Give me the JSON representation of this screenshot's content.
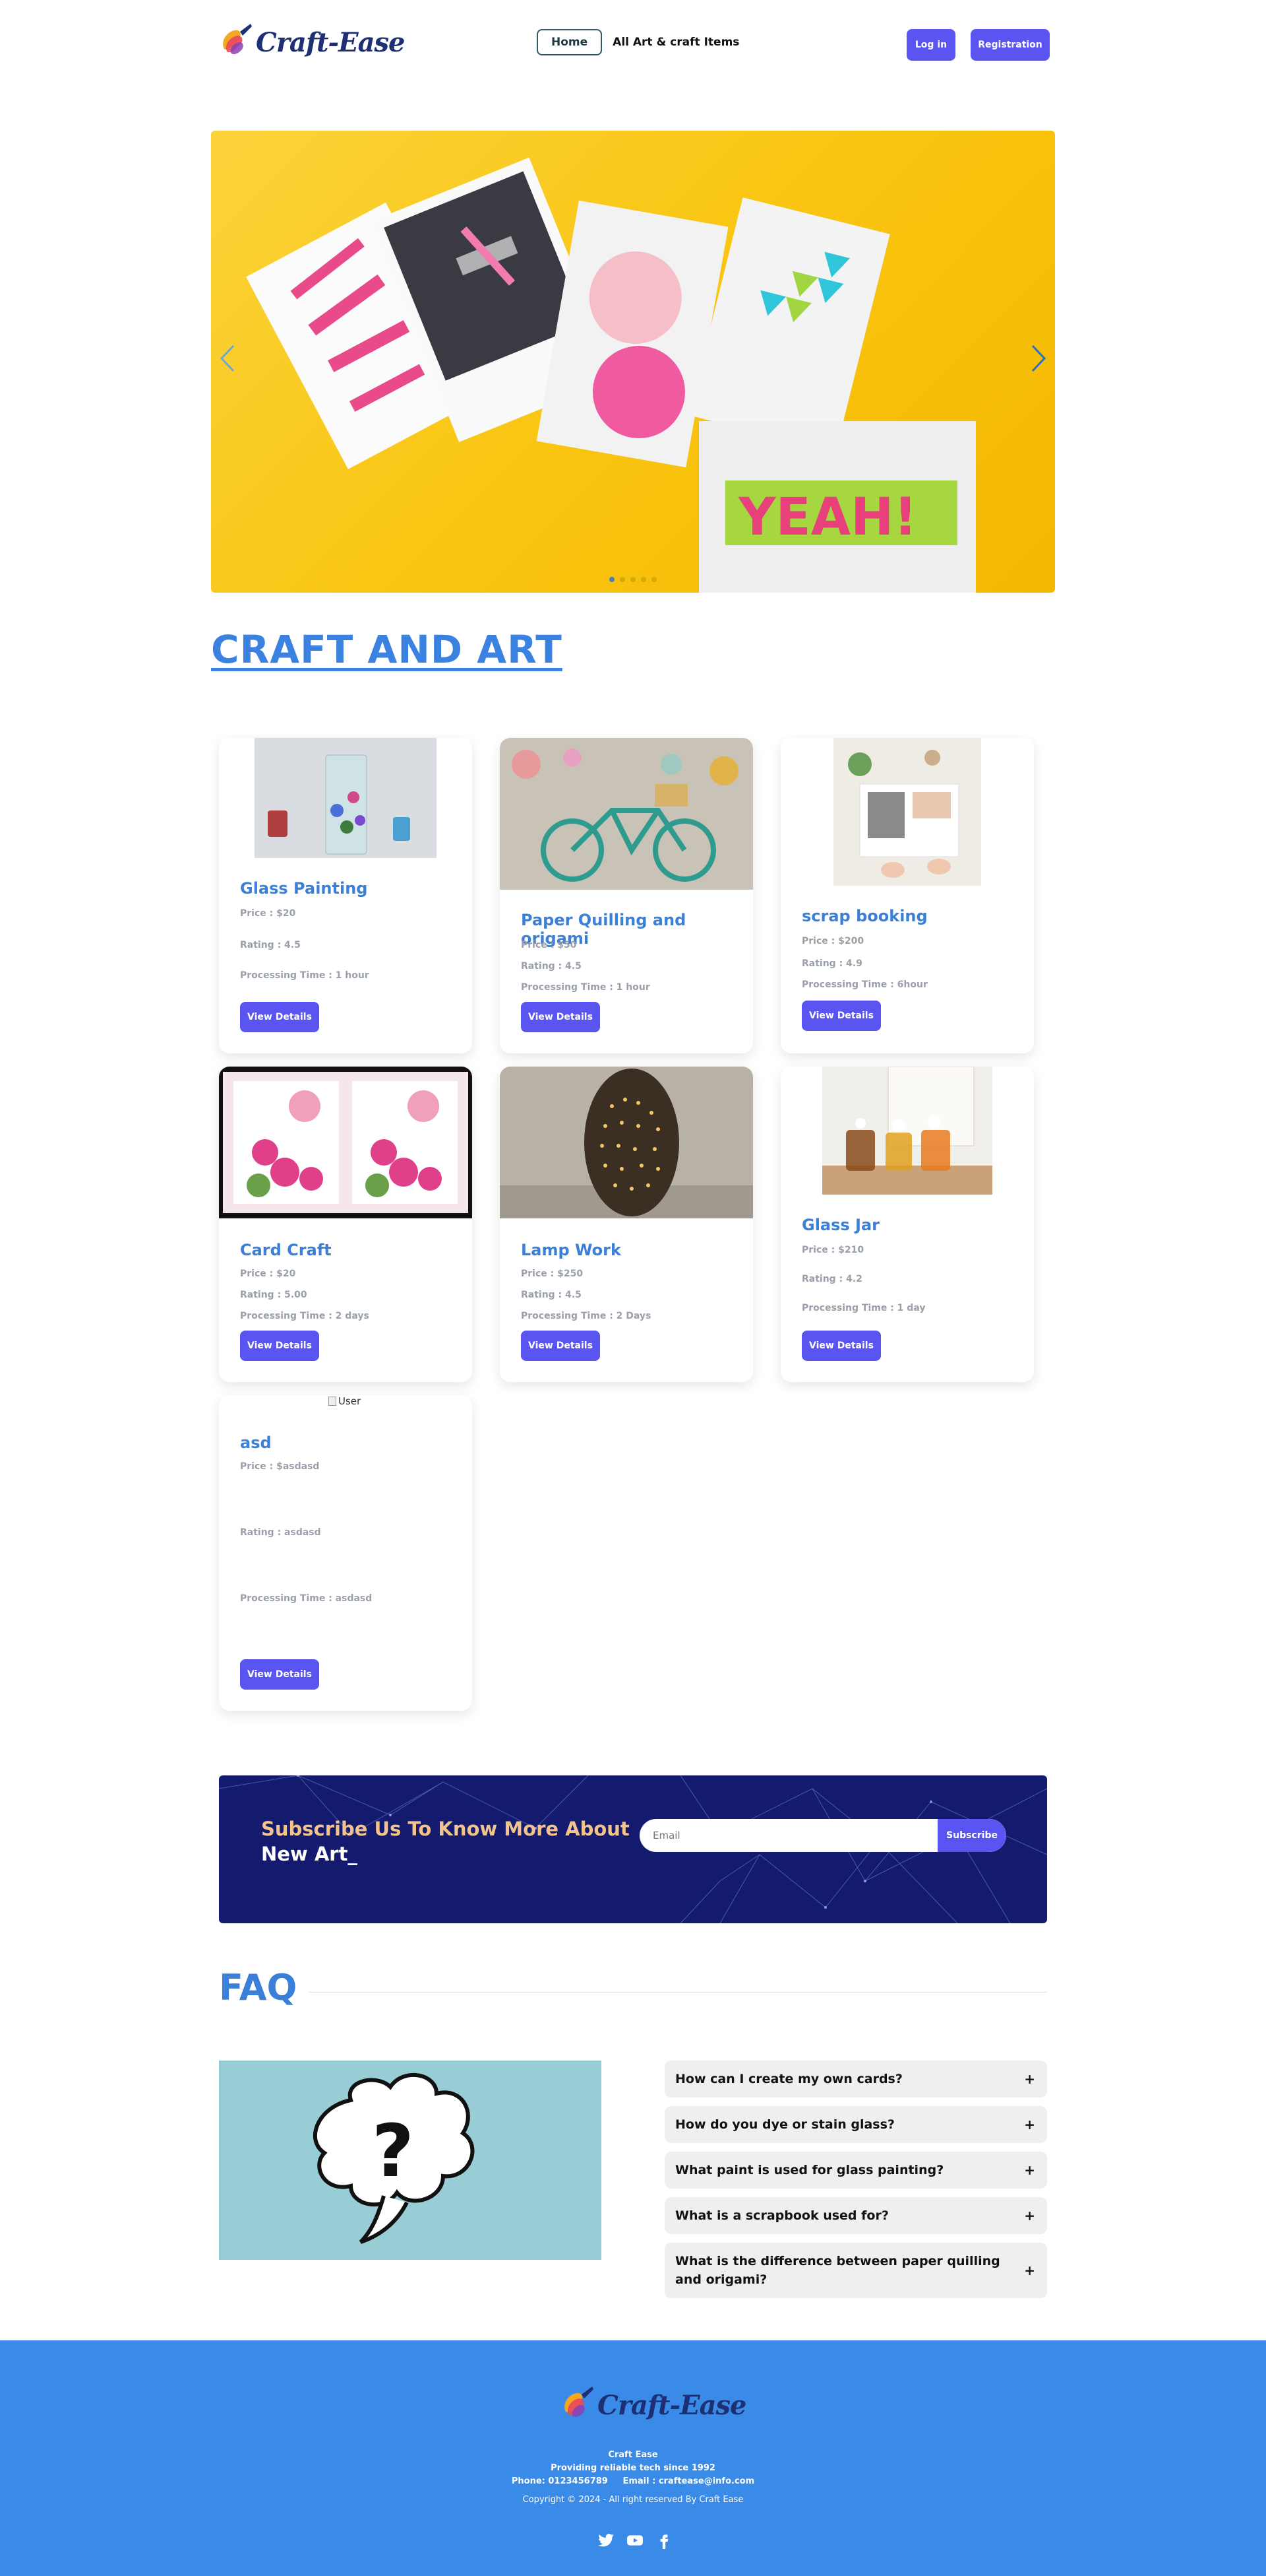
{
  "header": {
    "brand": "Craft-Ease",
    "nav": {
      "home": "Home",
      "all_items": "All Art & craft Items"
    },
    "login": "Log in",
    "registration": "Registration"
  },
  "slider": {
    "slide_count": 5,
    "active_index": 0
  },
  "section_title": "CRAFT AND ART",
  "cards": [
    {
      "title": "Glass Painting",
      "price": "Price : $20",
      "rating": "Rating : 4.5",
      "time": "Processing Time : 1 hour",
      "button": "View Details"
    },
    {
      "title": "Paper Quilling and origami",
      "price": "Price : $50",
      "rating": "Rating : 4.5",
      "time": "Processing Time : 1 hour",
      "button": "View Details"
    },
    {
      "title": "scrap booking",
      "price": "Price : $200",
      "rating": "Rating : 4.9",
      "time": "Processing Time : 6hour",
      "button": "View Details"
    },
    {
      "title": "Card Craft",
      "price": "Price : $20",
      "rating": "Rating : 5.00",
      "time": "Processing Time : 2 days",
      "button": "View Details"
    },
    {
      "title": "Lamp Work",
      "price": "Price : $250",
      "rating": "Rating : 4.5",
      "time": "Processing Time : 2 Days",
      "button": "View Details"
    },
    {
      "title": "Glass Jar",
      "price": "Price : $210",
      "rating": "Rating : 4.2",
      "time": "Processing Time : 1 day",
      "button": "View Details"
    },
    {
      "title": "asd",
      "image_alt": "User",
      "price": "Price : $asdasd",
      "rating": "Rating : asdasd",
      "time": "Processing Time : asdasd",
      "button": "View Details"
    }
  ],
  "subscribe": {
    "line1": "Subscribe Us To Know More About",
    "line2": "New Art_",
    "placeholder": "Email",
    "button": "Subscribe"
  },
  "faq": {
    "title": "FAQ",
    "items": [
      "How can I create my own cards?",
      "How do you dye or stain glass?",
      "What paint is used for glass painting?",
      "What is a scrapbook used for?",
      "What is the difference between paper quilling and origami?"
    ],
    "toggle": "+"
  },
  "footer": {
    "brand": "Craft-Ease",
    "name": "Craft Ease",
    "tagline": "Providing reliable tech since 1992",
    "contact": "Phone: 0123456789     Email : craftease@info.com",
    "copyright": "Copyright © 2024 - All right reserved By Craft Ease",
    "social": [
      "twitter-icon",
      "youtube-icon",
      "facebook-icon"
    ]
  },
  "colors": {
    "primary_button": "#5a55f0",
    "accent_blue": "#3a80d8",
    "footer_bg": "#3a8ae8",
    "subscribe_bg": "#141a6e"
  }
}
